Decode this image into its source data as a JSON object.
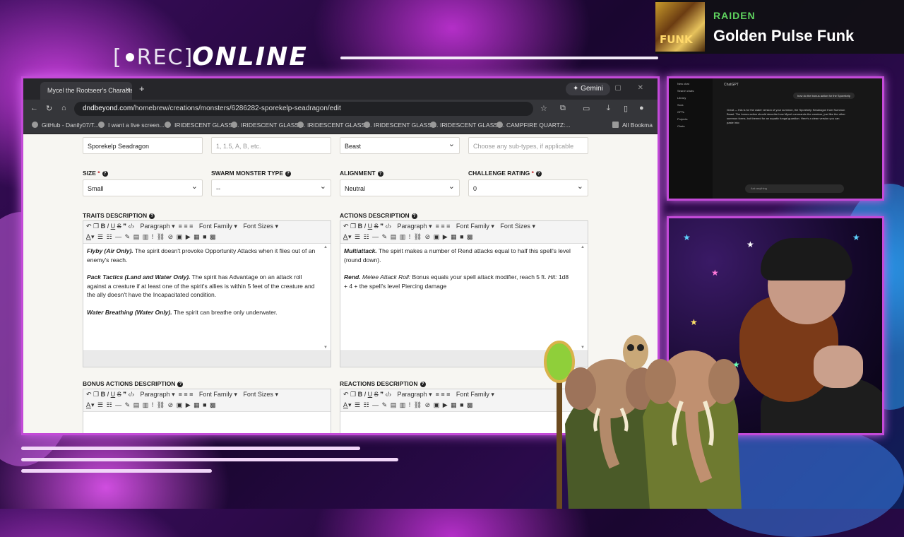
{
  "overlay": {
    "rec_label": "REC",
    "status_label": "ONLINE",
    "now_playing": {
      "artist": "RAIDEN",
      "title": "Golden Pulse Funk",
      "art_text": "FUNK"
    }
  },
  "browser": {
    "tab_title": "Mycel the Rootseer's Characte",
    "gemini_label": "Gemini",
    "url_domain": "dndbeyond.com",
    "url_path": "/homebrew/creations/monsters/6286282-sporekelp-seadragon/edit",
    "bookmarks": [
      "GitHub - Danily07/T...",
      "I want a live screen...",
      "IRIDESCENT GLASS:...",
      "IRIDESCENT GLASS:...",
      "IRIDESCENT GLASS:...",
      "IRIDESCENT GLASS:...",
      "IRIDESCENT GLASS:...",
      "CAMPFIRE QUARTZ:...",
      "All Bookma"
    ]
  },
  "form": {
    "name_value": "Sporekelp Seadragon",
    "size_variants_placeholder": "1, 1.5, A, B, etc.",
    "type_value": "Beast",
    "subtypes_placeholder": "Choose any sub-types, if applicable",
    "size_label": "SIZE",
    "size_value": "Small",
    "swarm_label": "SWARM MONSTER TYPE",
    "swarm_value": "--",
    "alignment_label": "ALIGNMENT",
    "alignment_value": "Neutral",
    "cr_label": "CHALLENGE RATING",
    "cr_value": "0",
    "toolbar": {
      "paragraph": "Paragraph",
      "font_family": "Font Family",
      "font_sizes": "Font Sizes"
    },
    "traits": {
      "label": "TRAITS DESCRIPTION",
      "p1_title": "Flyby (Air Only).",
      "p1_text": " The spirit doesn't provoke Opportunity Attacks when it flies out of an enemy's reach.",
      "p2_title": "Pack Tactics (Land and Water Only).",
      "p2_text": " The spirit has Advantage on an attack roll against a creature if at least one of the spirit's allies is within 5 feet of the creature and the ally doesn't have the Incapacitated condition.",
      "p3_title": "Water Breathing (Water Only).",
      "p3_text": " The spirit can breathe only underwater."
    },
    "actions": {
      "label": "ACTIONS DESCRIPTION",
      "p1_title": "Multiattack.",
      "p1_text": " The spirit makes a number of Rend attacks equal to half this spell's level (round down).",
      "p2_title": "Rend.",
      "p2_attack": " Melee Attack Roll:",
      "p2_text1": " Bonus equals your spell attack modifier, reach 5 ft. ",
      "p2_hit": "Hit:",
      "p2_text2": " 1d8 + 4 + the spell's level Piercing damage"
    },
    "bonus_actions_label": "BONUS ACTIONS DESCRIPTION",
    "reactions_label": "REACTIONS DESCRIPTION"
  },
  "chat": {
    "header": "ChatGPT",
    "question": "how do the bonus action for the Sporekelp",
    "answer": "Great — this is for the water version of your summon, the Sporekelp Seadragon from Summon Beast. The bonus action should describe how Mycel commands the creature, just like the other summon forms, but themed for an aquatic fungal guardian. Here's a clean version you can paste into:",
    "input_placeholder": "Ask anything",
    "sidebar": [
      "New chat",
      "Search chats",
      "Library",
      "Sora",
      "GPTs",
      "Projects",
      "Chats"
    ]
  },
  "colors": {
    "accent": "#c34ad8",
    "playing_artist": "#5fd35f"
  }
}
